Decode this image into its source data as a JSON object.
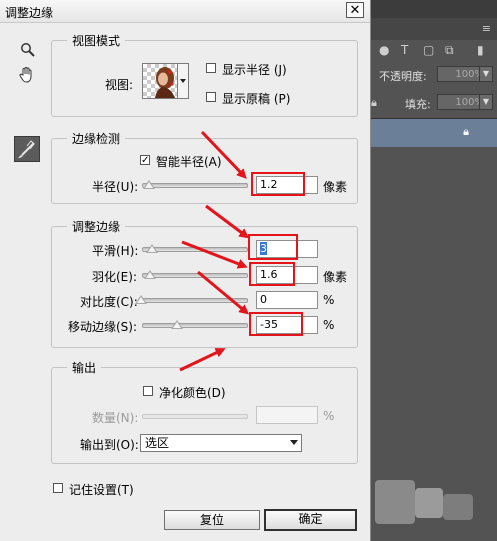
{
  "dialog": {
    "title": "调整边缘",
    "close_glyph": "✕"
  },
  "view_mode": {
    "group_title": "视图模式",
    "view_label": "视图:",
    "show_radius_label": "显示半径 (J)",
    "show_original_label": "显示原稿 (P)",
    "show_radius_checked": false,
    "show_original_checked": false
  },
  "edge_detection": {
    "group_title": "边缘检测",
    "smart_radius_label": "智能半径(A)",
    "smart_radius_checked": true,
    "radius_label": "半径(U):",
    "radius_value": "1.2",
    "radius_unit": "像素"
  },
  "adjust_edge": {
    "group_title": "调整边缘",
    "smooth_label": "平滑(H):",
    "smooth_value": "3",
    "feather_label": "羽化(E):",
    "feather_value": "1.6",
    "feather_unit": "像素",
    "contrast_label": "对比度(C):",
    "contrast_value": "0",
    "contrast_unit": "%",
    "shift_label": "移动边缘(S):",
    "shift_value": "-35",
    "shift_unit": "%"
  },
  "output": {
    "group_title": "输出",
    "decontaminate_label": "净化颜色(D)",
    "decontaminate_checked": false,
    "amount_label": "数量(N):",
    "amount_value": "",
    "amount_unit": "%",
    "output_to_label": "输出到(O):",
    "output_to_value": "选区"
  },
  "remember_label": "记住设置(T)",
  "remember_checked": false,
  "buttons": {
    "reset": "复位",
    "ok": "确定"
  },
  "background_panel": {
    "opacity_label": "不透明度:",
    "opacity_value": "100%",
    "fill_label": "填充:",
    "fill_value": "100%"
  },
  "icons": {
    "zoom": "magnifier-icon",
    "hand": "hand-icon",
    "brush": "refine-radius-brush-icon",
    "close": "close-icon"
  },
  "colors": {
    "highlight_box": "#e4141b",
    "arrow": "#e4141b",
    "dialog_bg": "#ededed",
    "ps_panel_bg": "#535353"
  }
}
